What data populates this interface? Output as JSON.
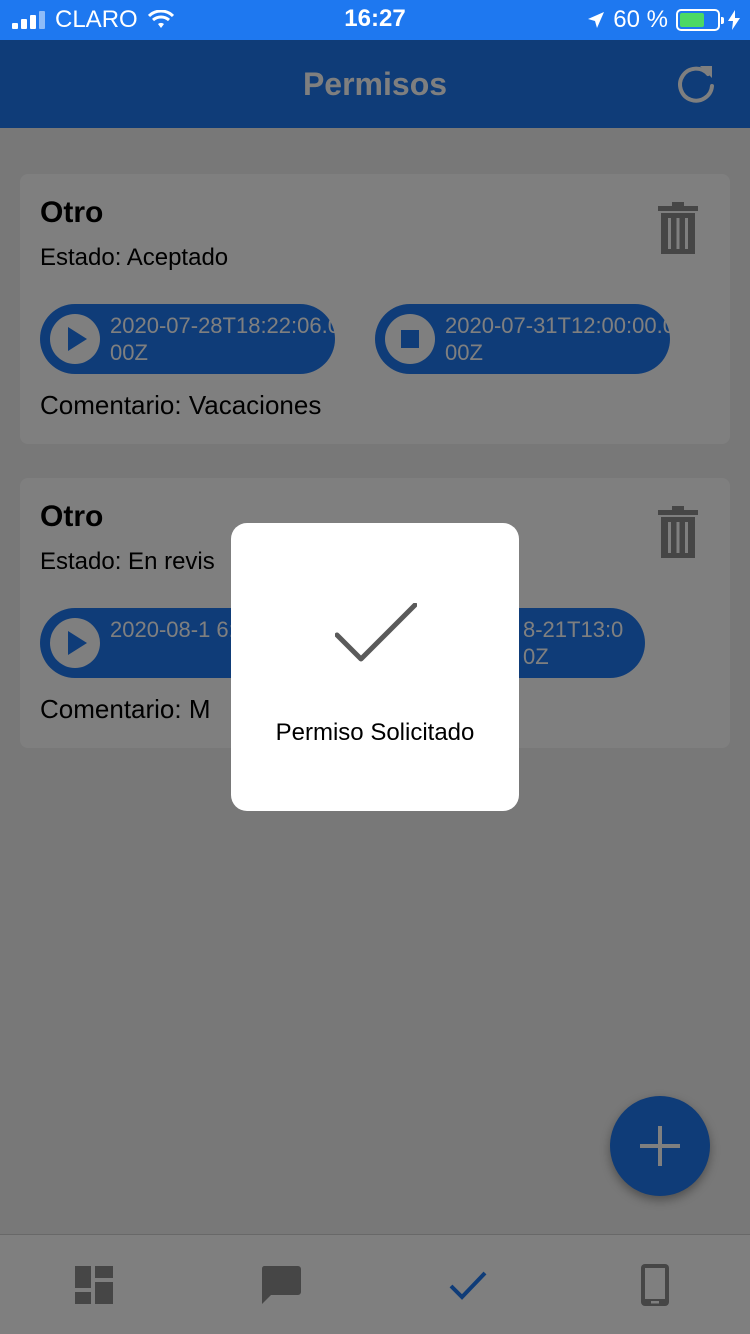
{
  "status_bar": {
    "carrier": "CLARO",
    "time": "16:27",
    "battery_percent": "60 %",
    "battery_level": 0.6
  },
  "header": {
    "title": "Permisos",
    "refresh_icon": "refresh-icon"
  },
  "permits": [
    {
      "title": "Otro",
      "status": "Estado: Aceptado",
      "start": "2020-07-28T18:22:06.000Z",
      "end": "2020-07-31T12:00:00.000Z",
      "comment": "Comentario: Vacaciones"
    },
    {
      "title": "Otro",
      "status": "Estado: En revis",
      "start": "2020-08-1 6:41.000Z",
      "end": "8-21T13:0 0Z",
      "comment": "Comentario: M"
    }
  ],
  "fab": {
    "icon": "plus-icon"
  },
  "tabbar": {
    "tabs": [
      {
        "icon": "dashboard-icon",
        "active": false
      },
      {
        "icon": "chat-icon",
        "active": false
      },
      {
        "icon": "check-icon",
        "active": true
      },
      {
        "icon": "phone-icon",
        "active": false
      }
    ]
  },
  "toast": {
    "message": "Permiso Solicitado",
    "icon": "checkmark-icon"
  },
  "colors": {
    "primary": "#1e78f0",
    "overlay": "rgba(0,0,0,0.5)",
    "icon_gray": "#8c8c8c"
  }
}
